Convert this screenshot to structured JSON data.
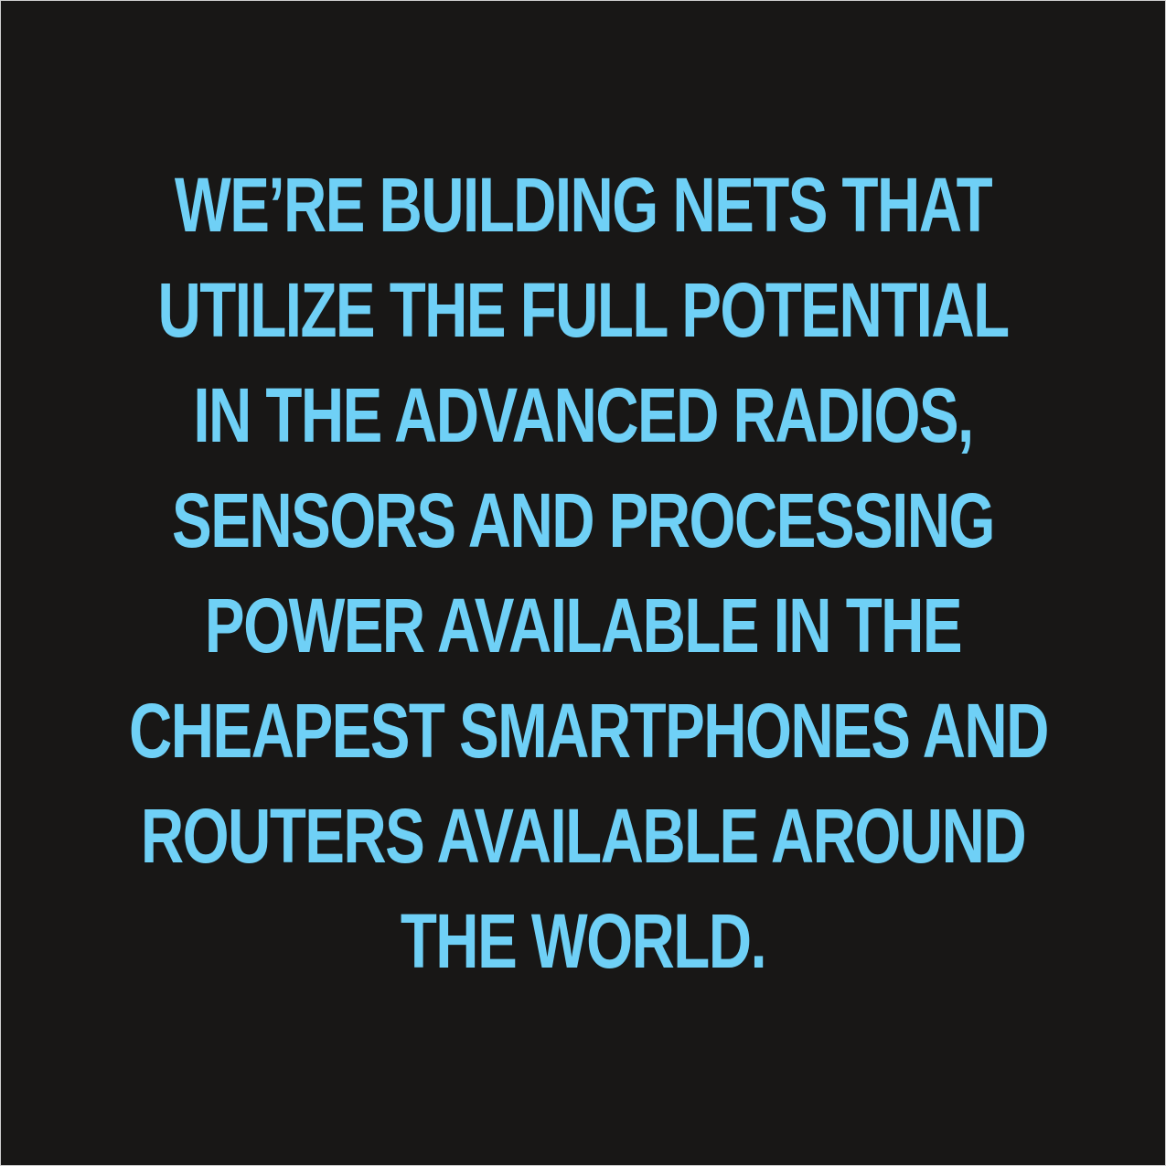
{
  "colors": {
    "background": "#181716",
    "text": "#6fd0f6"
  },
  "quote": {
    "lines": [
      "WE’RE BUILDING NETS THAT",
      "UTILIZE THE FULL POTENTIAL",
      "IN THE ADVANCED RADIOS,",
      "SENSORS AND PROCESSING",
      "POWER AVAILABLE IN THE",
      "CHEAPEST SMARTPHONES AND",
      "ROUTERS AVAILABLE AROUND",
      "THE WORLD."
    ]
  }
}
